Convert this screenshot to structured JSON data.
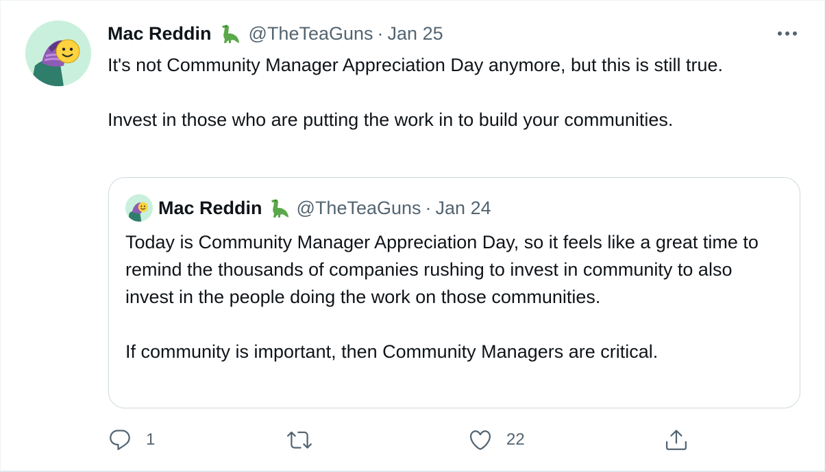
{
  "tweet": {
    "author_name": "Mac Reddin",
    "author_emoji": "🦕",
    "handle": "@TheTeaGuns",
    "separator": "·",
    "date": "Jan 25",
    "more_icon": "more-horizontal-icon",
    "text": [
      "It's not Community Manager Appreciation Day anymore, but this is still true.",
      "Invest in those who are putting the work in to build your communities."
    ]
  },
  "quote": {
    "author_name": "Mac Reddin",
    "author_emoji": "🦕",
    "handle": "@TheTeaGuns",
    "separator": "·",
    "date": "Jan 24",
    "text": [
      "Today is Community Manager Appreciation Day, so it feels like a great time to remind the thousands of companies rushing to invest in community to also invest in the people doing the work on those communities.",
      "If community is important, then Community Managers are critical."
    ]
  },
  "actions": {
    "reply": {
      "icon": "reply-icon",
      "count": "1"
    },
    "retweet": {
      "icon": "retweet-icon",
      "count": ""
    },
    "like": {
      "icon": "heart-icon",
      "count": "22"
    },
    "share": {
      "icon": "share-icon",
      "count": ""
    }
  },
  "colors": {
    "text": "#0f1419",
    "secondary": "#536471",
    "border": "#cfd9de",
    "avatar_bg": "#c9f0dc"
  }
}
